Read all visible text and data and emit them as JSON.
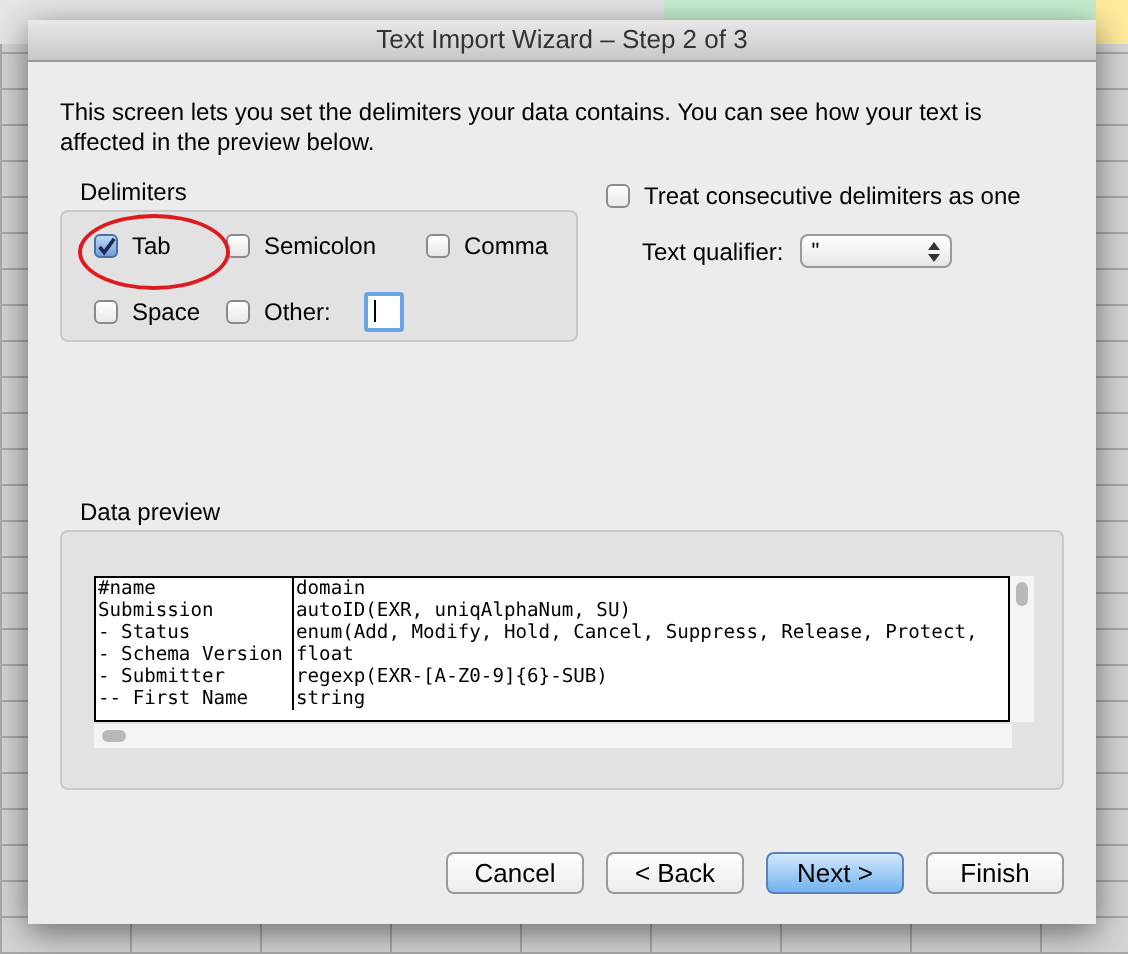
{
  "window": {
    "title": "Text Import Wizard – Step 2 of 3"
  },
  "intro": "This screen lets you set the delimiters your data contains.  You can see how your text is affected in the preview below.",
  "delimiters": {
    "title": "Delimiters",
    "options": [
      {
        "label": "Tab",
        "checked": true,
        "highlighted": true
      },
      {
        "label": "Semicolon",
        "checked": false,
        "highlighted": false
      },
      {
        "label": "Comma",
        "checked": false,
        "highlighted": false
      },
      {
        "label": "Space",
        "checked": false,
        "highlighted": false
      },
      {
        "label": "Other:",
        "checked": false,
        "highlighted": false
      }
    ]
  },
  "treat_consecutive": {
    "label": "Treat consecutive delimiters as one",
    "checked": false
  },
  "text_qualifier": {
    "label": "Text qualifier:",
    "value": "\""
  },
  "data_preview": {
    "title": "Data preview",
    "rows": [
      [
        "#name",
        "domain"
      ],
      [
        "Submission",
        "autoID(EXR, uniqAlphaNum, SU)"
      ],
      [
        "- Status",
        "enum(Add, Modify, Hold, Cancel, Suppress, Release, Protect,"
      ],
      [
        "- Schema Version",
        "float"
      ],
      [
        "- Submitter",
        "regexp(EXR-[A-Z0-9]{6}-SUB)"
      ],
      [
        "-- First Name",
        "string"
      ]
    ]
  },
  "buttons": [
    {
      "label": "Cancel",
      "default": false
    },
    {
      "label": "< Back",
      "default": false
    },
    {
      "label": "Next >",
      "default": true
    },
    {
      "label": "Finish",
      "default": false
    }
  ]
}
